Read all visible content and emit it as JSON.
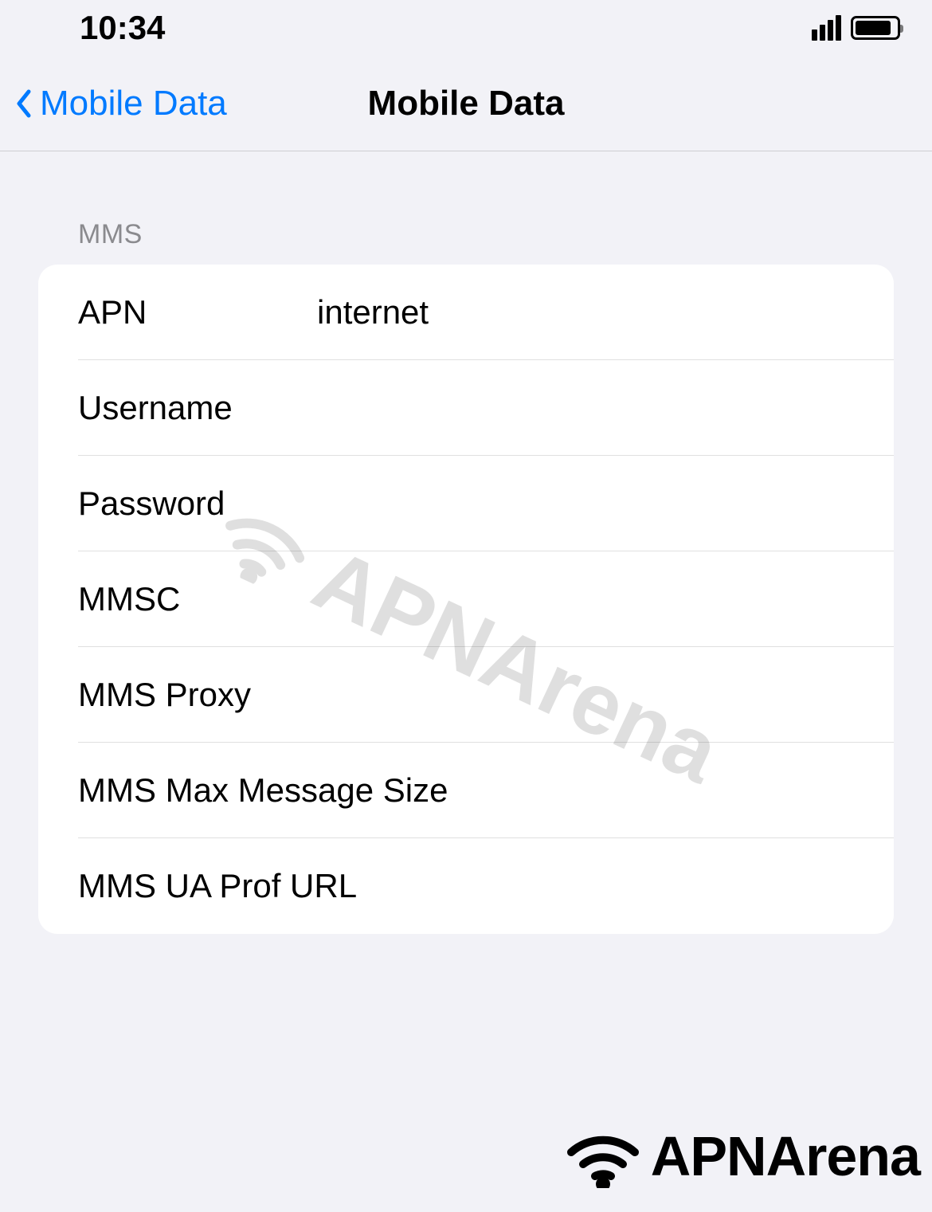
{
  "statusBar": {
    "time": "10:34"
  },
  "navBar": {
    "backLabel": "Mobile Data",
    "title": "Mobile Data"
  },
  "section": {
    "header": "MMS",
    "rows": [
      {
        "label": "APN",
        "value": "internet"
      },
      {
        "label": "Username",
        "value": ""
      },
      {
        "label": "Password",
        "value": ""
      },
      {
        "label": "MMSC",
        "value": ""
      },
      {
        "label": "MMS Proxy",
        "value": ""
      },
      {
        "label": "MMS Max Message Size",
        "value": ""
      },
      {
        "label": "MMS UA Prof URL",
        "value": ""
      }
    ]
  },
  "watermark": {
    "text": "APNArena"
  },
  "footer": {
    "text": "APNArena"
  }
}
